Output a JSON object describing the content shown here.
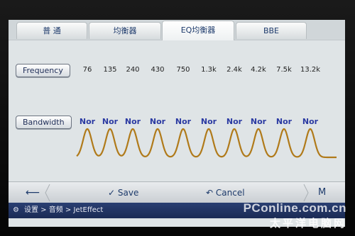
{
  "tabs": [
    {
      "label": "普 通"
    },
    {
      "label": "均衡器"
    },
    {
      "label": "EQ均衡器"
    },
    {
      "label": "BBE"
    }
  ],
  "active_tab": 2,
  "frequency_button": "Frequency",
  "bandwidth_button": "Bandwidth",
  "frequencies": [
    "76",
    "135",
    "240",
    "430",
    "750",
    "1.3k",
    "2.4k",
    "4.2k",
    "7.5k",
    "13.2k"
  ],
  "bandwidths": [
    "Nor",
    "Nor",
    "Nor",
    "Nor",
    "Nor",
    "Nor",
    "Nor",
    "Nor",
    "Nor",
    "Nor"
  ],
  "toolbar": {
    "back_icon": "arrow-left-icon",
    "save_label": "Save",
    "cancel_label": "Cancel",
    "m_label": "M"
  },
  "statusbar": {
    "path": "设置 > 音频 > JetEffect"
  },
  "watermark": {
    "line1": "PConline.com.cn",
    "line2": "太平洋电脑网"
  },
  "colors": {
    "wave": "#b07a1a",
    "nor": "#2b3aa2",
    "status": "#1b2b55"
  }
}
